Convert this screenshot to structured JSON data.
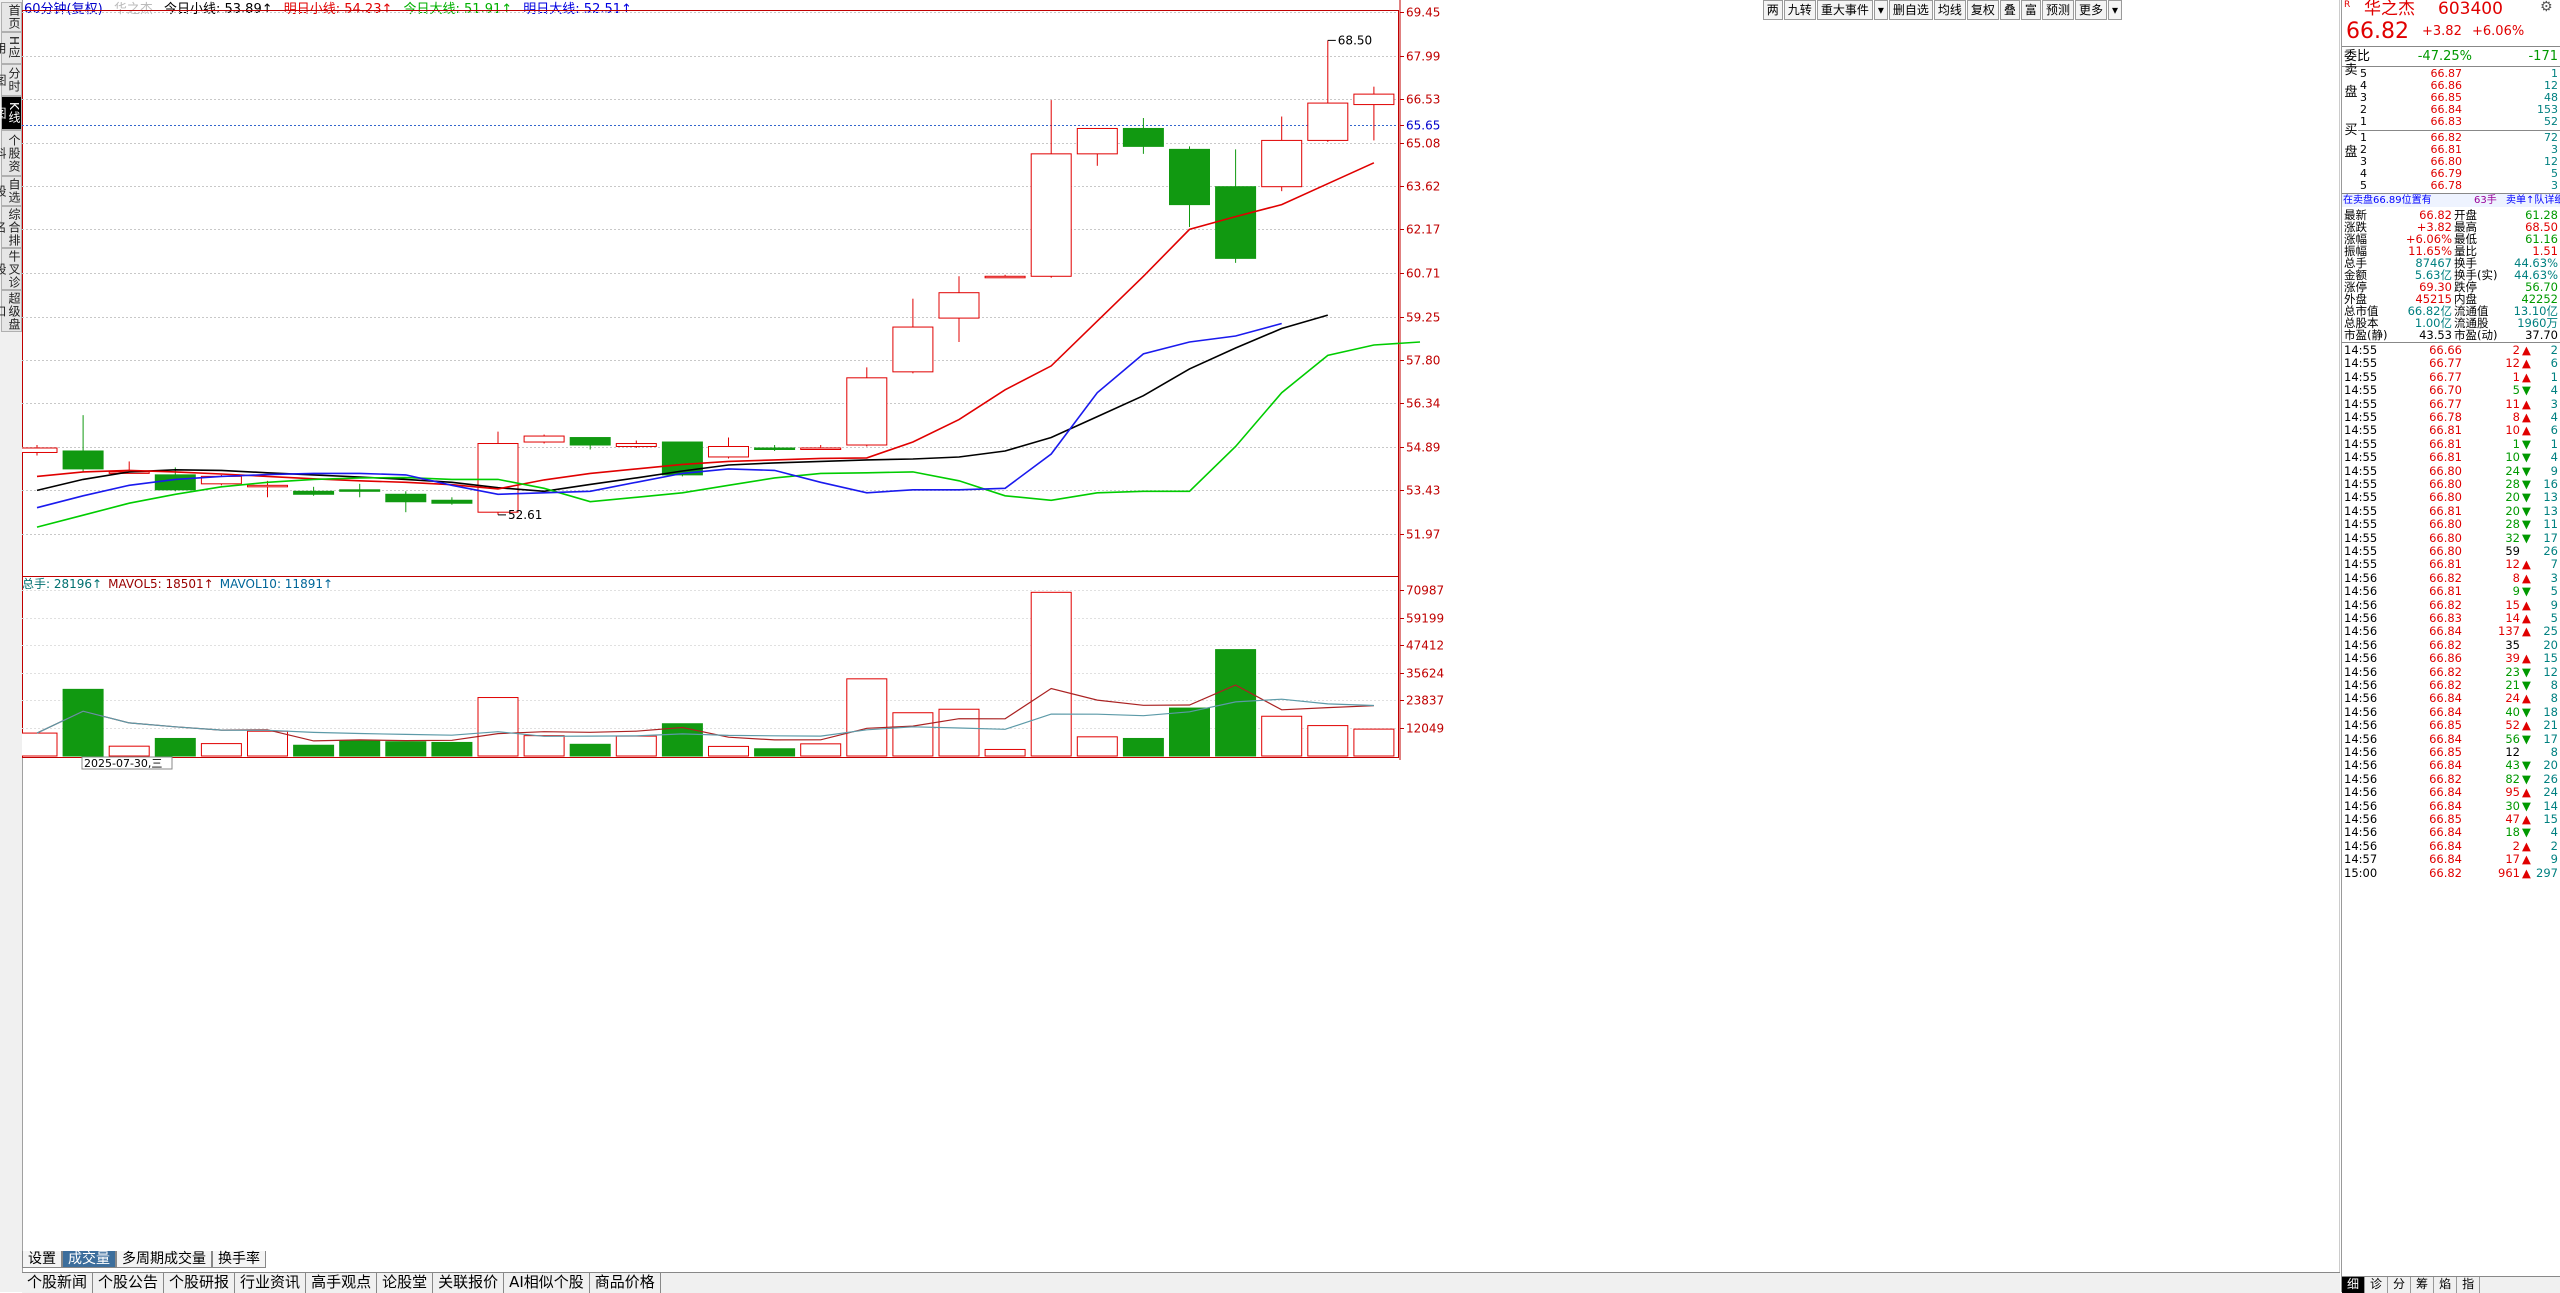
{
  "top_bar": {
    "period": "60分钟(复权)",
    "stock_name_faint": "华之杰",
    "items": [
      {
        "text": "今日小线: 53.89↑",
        "color": "#000000"
      },
      {
        "text": "明日小线: 54.23↑",
        "color": "#e00000"
      },
      {
        "text": "今日大线: 51.91↑",
        "color": "#00b000"
      },
      {
        "text": "明日大线: 52.51↑",
        "color": "#0000e0"
      }
    ]
  },
  "toolbar": [
    "两",
    "九转",
    "重大事件",
    "▾",
    "删自选",
    "均线",
    "复权",
    "叠",
    "富",
    "预测",
    "更多",
    "▾"
  ],
  "sidebar": [
    "首页",
    "H应用",
    "分时图",
    "K线图",
    "个股资料",
    "自选股",
    "综合排名",
    "牛叉诊股",
    "超级盘口"
  ],
  "price_axis": [
    "69.45",
    "67.99",
    "66.53",
    "65.65",
    "65.08",
    "63.62",
    "62.17",
    "60.71",
    "59.25",
    "57.80",
    "56.34",
    "54.89",
    "53.43",
    "51.97"
  ],
  "high_label": "68.50",
  "low_label": "52.61",
  "volume_title": {
    "total": "总手: 28196↑",
    "mavol5": "MAVOL5: 18501↑",
    "mavol10": "MAVOL10: 11891↑"
  },
  "volume_axis": [
    "70987",
    "59199",
    "47412",
    "35624",
    "23837",
    "12049"
  ],
  "date_label": "2025-07-30,三",
  "bottom_tabs": [
    "设置",
    "成交量",
    "多周期成交量",
    "换手率"
  ],
  "news_tabs": [
    "个股新闻",
    "个股公告",
    "个股研报",
    "行业资讯",
    "高手观点",
    "论股堂",
    "关联报价",
    "AI相似个股",
    "商品价格"
  ],
  "chart_data": {
    "type": "candlestick",
    "period": "60分钟",
    "ylim": [
      51.4,
      69.6
    ],
    "bars": [
      {
        "o": 54.7,
        "h": 54.95,
        "c": 54.85,
        "l": 54.6,
        "v": 9800
      },
      {
        "o": 54.75,
        "h": 55.95,
        "c": 54.15,
        "l": 54.05,
        "v": 28500
      },
      {
        "o": 54.05,
        "h": 54.4,
        "c": 54.05,
        "l": 54.0,
        "v": 4200
      },
      {
        "o": 53.95,
        "h": 54.2,
        "c": 53.45,
        "l": 53.4,
        "v": 7500
      },
      {
        "o": 53.65,
        "h": 53.95,
        "c": 53.9,
        "l": 53.6,
        "v": 5300
      },
      {
        "o": 53.55,
        "h": 53.75,
        "c": 53.6,
        "l": 53.2,
        "v": 10600
      },
      {
        "o": 53.4,
        "h": 53.55,
        "c": 53.3,
        "l": 53.25,
        "v": 4600
      },
      {
        "o": 53.45,
        "h": 53.65,
        "c": 53.4,
        "l": 53.2,
        "v": 6400
      },
      {
        "o": 53.3,
        "h": 53.4,
        "c": 53.05,
        "l": 52.7,
        "v": 6100
      },
      {
        "o": 53.1,
        "h": 53.2,
        "c": 53.0,
        "l": 52.95,
        "v": 5800
      },
      {
        "o": 52.7,
        "h": 55.4,
        "c": 55.0,
        "l": 52.61,
        "v": 25000
      },
      {
        "o": 55.05,
        "h": 55.3,
        "c": 55.25,
        "l": 55.0,
        "v": 8700
      },
      {
        "o": 55.2,
        "h": 55.2,
        "c": 54.95,
        "l": 54.8,
        "v": 5000
      },
      {
        "o": 54.9,
        "h": 55.1,
        "c": 55.0,
        "l": 54.85,
        "v": 8500
      },
      {
        "o": 55.05,
        "h": 55.05,
        "c": 53.95,
        "l": 53.9,
        "v": 13800
      },
      {
        "o": 54.55,
        "h": 55.2,
        "c": 54.9,
        "l": 54.5,
        "v": 4100
      },
      {
        "o": 54.85,
        "h": 54.95,
        "c": 54.8,
        "l": 54.75,
        "v": 3100
      },
      {
        "o": 54.85,
        "h": 54.95,
        "c": 54.85,
        "l": 54.8,
        "v": 5200
      },
      {
        "o": 54.95,
        "h": 57.55,
        "c": 57.2,
        "l": 54.9,
        "v": 33000
      },
      {
        "o": 57.4,
        "h": 59.85,
        "c": 58.9,
        "l": 57.35,
        "v": 18500
      },
      {
        "o": 59.2,
        "h": 60.6,
        "c": 60.05,
        "l": 58.4,
        "v": 20000
      },
      {
        "o": 60.6,
        "h": 60.65,
        "c": 60.6,
        "l": 60.55,
        "v": 2800
      },
      {
        "o": 60.6,
        "h": 66.5,
        "c": 64.7,
        "l": 60.55,
        "v": 70000
      },
      {
        "o": 64.7,
        "h": 65.55,
        "c": 65.55,
        "l": 64.3,
        "v": 8200
      },
      {
        "o": 65.55,
        "h": 65.9,
        "c": 64.95,
        "l": 64.7,
        "v": 7500
      },
      {
        "o": 64.85,
        "h": 64.95,
        "c": 63.0,
        "l": 62.25,
        "v": 20500
      },
      {
        "o": 63.6,
        "h": 64.85,
        "c": 61.2,
        "l": 61.05,
        "v": 45500
      },
      {
        "o": 63.6,
        "h": 65.95,
        "c": 65.15,
        "l": 63.45,
        "v": 17000
      },
      {
        "o": 65.15,
        "h": 68.5,
        "c": 66.4,
        "l": 65.1,
        "v": 13000
      },
      {
        "o": 66.35,
        "h": 66.95,
        "c": 66.7,
        "l": 65.15,
        "v": 11500
      }
    ],
    "ma_small_today": [
      53.43,
      53.8,
      54.05,
      54.12,
      54.1,
      54.02,
      53.95,
      53.88,
      53.8,
      53.7,
      53.52,
      53.4,
      53.63,
      53.85,
      54.08,
      54.28,
      54.35,
      54.4,
      54.45,
      54.48,
      54.55,
      54.75,
      55.2,
      55.9,
      56.6,
      57.5,
      58.2,
      58.85,
      59.3
    ],
    "ma_small_tomorrow": [
      53.9,
      54.05,
      54.1,
      54.05,
      53.98,
      53.9,
      53.82,
      53.75,
      53.7,
      53.62,
      53.48,
      53.78,
      54.0,
      54.15,
      54.3,
      54.4,
      54.45,
      54.5,
      54.52,
      55.05,
      55.8,
      56.8,
      57.6,
      59.1,
      60.6,
      62.17,
      62.6,
      63.0,
      63.7,
      64.4
    ],
    "ma_large_today": [
      52.2,
      52.6,
      53.0,
      53.3,
      53.55,
      53.7,
      53.8,
      53.85,
      53.86,
      53.8,
      53.8,
      53.5,
      53.05,
      53.2,
      53.35,
      53.6,
      53.85,
      54.0,
      54.02,
      54.05,
      53.75,
      53.25,
      53.1,
      53.35,
      53.4,
      53.4,
      54.9,
      56.7,
      57.95,
      58.3,
      58.4
    ],
    "ma_large_tomorrow": [
      52.85,
      53.25,
      53.6,
      53.8,
      53.9,
      53.96,
      54.0,
      54.0,
      53.95,
      53.6,
      53.3,
      53.35,
      53.4,
      53.7,
      54.0,
      54.15,
      54.1,
      53.7,
      53.35,
      53.45,
      53.45,
      53.5,
      54.65,
      56.7,
      58.0,
      58.4,
      58.6,
      59.02
    ]
  },
  "right_panel": {
    "title_name": "华之杰",
    "title_code": "603400",
    "price": "66.82",
    "change": "+3.82",
    "change_pct": "+6.06%",
    "weibi_label": "委比",
    "weibi_pct": "-47.25%",
    "weibi_diff": "-171",
    "sell_label": "卖盘",
    "buy_label": "买盘",
    "sell": [
      {
        "level": "5",
        "price": "66.87",
        "vol": "1"
      },
      {
        "level": "4",
        "price": "66.86",
        "vol": "12"
      },
      {
        "level": "3",
        "price": "66.85",
        "vol": "48"
      },
      {
        "level": "2",
        "price": "66.84",
        "vol": "153"
      },
      {
        "level": "1",
        "price": "66.83",
        "vol": "52"
      }
    ],
    "buy": [
      {
        "level": "1",
        "price": "66.82",
        "vol": "72"
      },
      {
        "level": "2",
        "price": "66.81",
        "vol": "3"
      },
      {
        "level": "3",
        "price": "66.80",
        "vol": "12"
      },
      {
        "level": "4",
        "price": "66.79",
        "vol": "5"
      },
      {
        "level": "5",
        "price": "66.78",
        "vol": "3"
      }
    ],
    "order_bar": [
      "在卖盘66.89位置有",
      "63手",
      "卖单↑队详细"
    ],
    "stats": [
      {
        "l1": "最新",
        "v1": "66.82",
        "c1": "red",
        "l2": "开盘",
        "v2": "61.28",
        "c2": "green"
      },
      {
        "l1": "涨跌",
        "v1": "+3.82",
        "c1": "red",
        "l2": "最高",
        "v2": "68.50",
        "c2": "red"
      },
      {
        "l1": "涨幅",
        "v1": "+6.06%",
        "c1": "red",
        "l2": "最低",
        "v2": "61.16",
        "c2": "green"
      },
      {
        "l1": "振幅",
        "v1": "11.65%",
        "c1": "red",
        "l2": "量比",
        "v2": "1.51",
        "c2": "red"
      },
      {
        "l1": "总手",
        "v1": "87467",
        "c1": "teal",
        "l2": "换手",
        "v2": "44.63%",
        "c2": "teal"
      },
      {
        "l1": "金额",
        "v1": "5.63亿",
        "c1": "teal",
        "l2": "换手(实)",
        "v2": "44.63%",
        "c2": "teal"
      },
      {
        "l1": "涨停",
        "v1": "69.30",
        "c1": "red",
        "l2": "跌停",
        "v2": "56.70",
        "c2": "green"
      },
      {
        "l1": "外盘",
        "v1": "45215",
        "c1": "red",
        "l2": "内盘",
        "v2": "42252",
        "c2": "green"
      },
      {
        "l1": "总市值",
        "v1": "66.82亿",
        "c1": "teal",
        "l2": "流通值",
        "v2": "13.10亿",
        "c2": "teal"
      },
      {
        "l1": "总股本",
        "v1": "1.00亿",
        "c1": "teal",
        "l2": "流通股",
        "v2": "1960万",
        "c2": "teal"
      },
      {
        "l1": "市盈(静)",
        "v1": "43.53",
        "c1": "black",
        "l2": "市盈(动)",
        "v2": "37.70",
        "c2": "black"
      }
    ],
    "ticks": [
      {
        "t": "14:55",
        "p": "66.66",
        "v": "2",
        "d": "up",
        "n": "2"
      },
      {
        "t": "14:55",
        "p": "66.77",
        "v": "12",
        "d": "up",
        "n": "6"
      },
      {
        "t": "14:55",
        "p": "66.77",
        "v": "1",
        "d": "up",
        "n": "1"
      },
      {
        "t": "14:55",
        "p": "66.70",
        "v": "5",
        "d": "down",
        "n": "4"
      },
      {
        "t": "14:55",
        "p": "66.77",
        "v": "11",
        "d": "up",
        "n": "3"
      },
      {
        "t": "14:55",
        "p": "66.78",
        "v": "8",
        "d": "up",
        "n": "4"
      },
      {
        "t": "14:55",
        "p": "66.81",
        "v": "10",
        "d": "up",
        "n": "6"
      },
      {
        "t": "14:55",
        "p": "66.81",
        "v": "1",
        "d": "down",
        "n": "1"
      },
      {
        "t": "14:55",
        "p": "66.81",
        "v": "10",
        "d": "down",
        "n": "4"
      },
      {
        "t": "14:55",
        "p": "66.80",
        "v": "24",
        "d": "down",
        "n": "9"
      },
      {
        "t": "14:55",
        "p": "66.80",
        "v": "28",
        "d": "down",
        "n": "16"
      },
      {
        "t": "14:55",
        "p": "66.80",
        "v": "20",
        "d": "down",
        "n": "13"
      },
      {
        "t": "14:55",
        "p": "66.81",
        "v": "20",
        "d": "down",
        "n": "13"
      },
      {
        "t": "14:55",
        "p": "66.80",
        "v": "28",
        "d": "down",
        "n": "11"
      },
      {
        "t": "14:55",
        "p": "66.80",
        "v": "32",
        "d": "down",
        "n": "17"
      },
      {
        "t": "14:55",
        "p": "66.80",
        "v": "59",
        "d": "none",
        "n": "26"
      },
      {
        "t": "14:55",
        "p": "66.81",
        "v": "12",
        "d": "up",
        "n": "7"
      },
      {
        "t": "14:56",
        "p": "66.82",
        "v": "8",
        "d": "up",
        "n": "3"
      },
      {
        "t": "14:56",
        "p": "66.81",
        "v": "9",
        "d": "down",
        "n": "5"
      },
      {
        "t": "14:56",
        "p": "66.82",
        "v": "15",
        "d": "up",
        "n": "9"
      },
      {
        "t": "14:56",
        "p": "66.83",
        "v": "14",
        "d": "up",
        "n": "5"
      },
      {
        "t": "14:56",
        "p": "66.84",
        "v": "137",
        "d": "up",
        "n": "25"
      },
      {
        "t": "14:56",
        "p": "66.82",
        "v": "35",
        "d": "none",
        "n": "20"
      },
      {
        "t": "14:56",
        "p": "66.86",
        "v": "39",
        "d": "up",
        "n": "15"
      },
      {
        "t": "14:56",
        "p": "66.82",
        "v": "23",
        "d": "down",
        "n": "12"
      },
      {
        "t": "14:56",
        "p": "66.82",
        "v": "21",
        "d": "down",
        "n": "8"
      },
      {
        "t": "14:56",
        "p": "66.84",
        "v": "24",
        "d": "up",
        "n": "8"
      },
      {
        "t": "14:56",
        "p": "66.84",
        "v": "40",
        "d": "down",
        "n": "18"
      },
      {
        "t": "14:56",
        "p": "66.85",
        "v": "52",
        "d": "up",
        "n": "21"
      },
      {
        "t": "14:56",
        "p": "66.84",
        "v": "56",
        "d": "down",
        "n": "17"
      },
      {
        "t": "14:56",
        "p": "66.85",
        "v": "12",
        "d": "none",
        "n": "8"
      },
      {
        "t": "14:56",
        "p": "66.84",
        "v": "43",
        "d": "down",
        "n": "20"
      },
      {
        "t": "14:56",
        "p": "66.82",
        "v": "82",
        "d": "down",
        "n": "26"
      },
      {
        "t": "14:56",
        "p": "66.84",
        "v": "95",
        "d": "up",
        "n": "24"
      },
      {
        "t": "14:56",
        "p": "66.84",
        "v": "30",
        "d": "down",
        "n": "14"
      },
      {
        "t": "14:56",
        "p": "66.85",
        "v": "47",
        "d": "up",
        "n": "15"
      },
      {
        "t": "14:56",
        "p": "66.84",
        "v": "18",
        "d": "down",
        "n": "4"
      },
      {
        "t": "14:56",
        "p": "66.84",
        "v": "2",
        "d": "up",
        "n": "2"
      },
      {
        "t": "14:57",
        "p": "66.84",
        "v": "17",
        "d": "up",
        "n": "9"
      },
      {
        "t": "15:00",
        "p": "66.82",
        "v": "961",
        "d": "up",
        "n": "297"
      }
    ],
    "bottom_tabs": [
      "细",
      "诊",
      "分",
      "筹",
      "焰",
      "指"
    ]
  }
}
